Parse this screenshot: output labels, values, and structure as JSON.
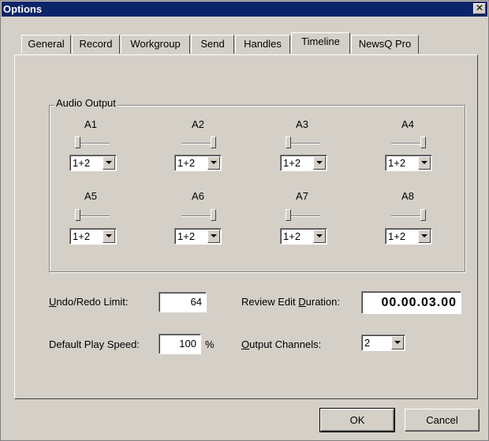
{
  "window": {
    "title": "Options",
    "close_glyph": "✕"
  },
  "tabs": [
    {
      "label": "General",
      "active": false
    },
    {
      "label": "Record",
      "active": false
    },
    {
      "label": "Workgroup",
      "active": false
    },
    {
      "label": "Send",
      "active": false
    },
    {
      "label": "Handles",
      "active": false
    },
    {
      "label": "Timeline",
      "active": true
    },
    {
      "label": "NewsQ Pro",
      "active": false
    }
  ],
  "audio_output": {
    "label": "Audio Output",
    "channels": [
      {
        "name": "A1",
        "level": 0,
        "route": "1+2"
      },
      {
        "name": "A2",
        "level": 1,
        "route": "1+2"
      },
      {
        "name": "A3",
        "level": 0,
        "route": "1+2"
      },
      {
        "name": "A4",
        "level": 1,
        "route": "1+2"
      },
      {
        "name": "A5",
        "level": 0,
        "route": "1+2"
      },
      {
        "name": "A6",
        "level": 1,
        "route": "1+2"
      },
      {
        "name": "A7",
        "level": 0,
        "route": "1+2"
      },
      {
        "name": "A8",
        "level": 1,
        "route": "1+2"
      }
    ]
  },
  "settings": {
    "undo_label_u": "U",
    "undo_label_rest": "ndo/Redo Limit:",
    "undo_value": "64",
    "speed_label": "Default Play Speed:",
    "speed_value": "100",
    "speed_unit": "%",
    "review_label_pre": "Review Edit ",
    "review_label_u": "D",
    "review_label_rest": "uration:",
    "review_value": "00.00.03.00",
    "output_label_u": "O",
    "output_label_rest": "utput Channels:",
    "output_value": "2"
  },
  "buttons": {
    "ok": "OK",
    "cancel": "Cancel"
  }
}
